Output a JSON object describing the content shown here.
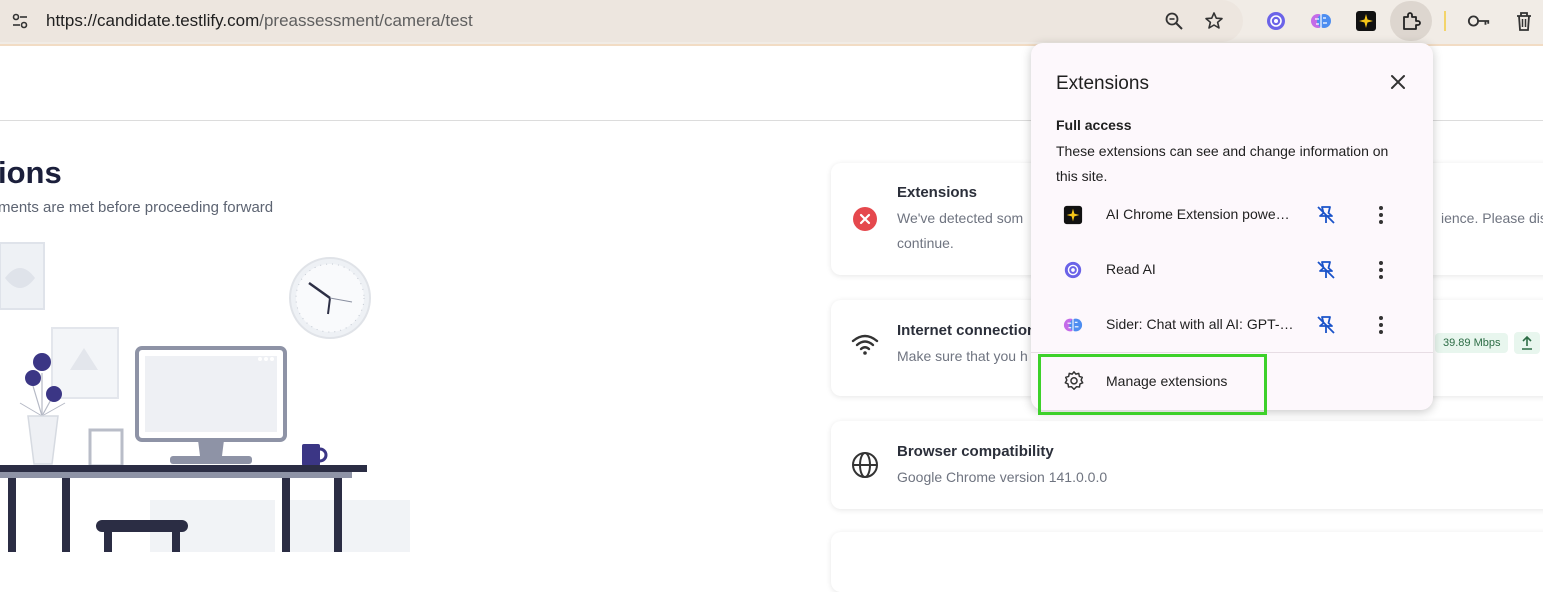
{
  "browser": {
    "url_host": "https://candidate.testlify.com",
    "url_path": "/preassessment/camera/test",
    "icons": [
      "tune-icon",
      "zoom-icon",
      "star-icon",
      "read-ai-icon",
      "sider-icon",
      "ai-chrome-extension-icon",
      "puzzle-icon",
      "key-icon",
      "trash-icon"
    ]
  },
  "page": {
    "title": "ions",
    "subtitle": "ments are met before proceeding forward"
  },
  "checks": [
    {
      "title": "Extensions",
      "text_line1": "We've detected som",
      "text_line1_end": "ience. Please disa",
      "text_line2": "continue.",
      "status": "error",
      "status_color": "#e5484d"
    },
    {
      "title": "Internet connection",
      "text_line1": "Make sure that you h",
      "download_speed": "39.89 Mbps"
    },
    {
      "title": "Browser compatibility",
      "text_line1": "Google Chrome version 141.0.0.0"
    }
  ],
  "popup": {
    "title": "Extensions",
    "section_title": "Full access",
    "section_desc": "These extensions can see and change information on this site.",
    "extensions": [
      {
        "name": "AI Chrome Extension powe…",
        "icon": "sparkle-icon"
      },
      {
        "name": "Read AI",
        "icon": "read-ai-icon"
      },
      {
        "name": "Sider: Chat with all AI: GPT-…",
        "icon": "sider-brain-icon"
      }
    ],
    "manage_label": "Manage extensions"
  },
  "colors": {
    "accent_highlight": "#3dd12a",
    "error": "#e5484d",
    "title_navy": "#1b1f3b"
  }
}
